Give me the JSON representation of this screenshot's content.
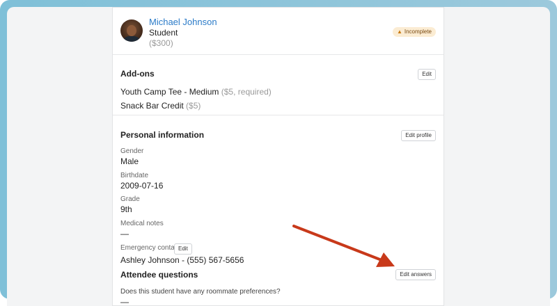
{
  "attendee": {
    "name": "Michael Johnson",
    "role": "Student",
    "price": "($300)",
    "status": "Incomplete"
  },
  "addons": {
    "title": "Add-ons",
    "edit_label": "Edit",
    "items": [
      {
        "label": "Youth Camp Tee - Medium",
        "detail": "($5, required)"
      },
      {
        "label": "Snack Bar Credit",
        "detail": "($5)"
      }
    ]
  },
  "personal": {
    "title": "Personal information",
    "edit_label": "Edit profile",
    "fields": [
      {
        "label": "Gender",
        "value": "Male"
      },
      {
        "label": "Birthdate",
        "value": "2009-07-16"
      },
      {
        "label": "Grade",
        "value": "9th"
      },
      {
        "label": "Medical notes",
        "value": "—"
      }
    ],
    "emergency": {
      "label": "Emergency contact",
      "edit_label": "Edit",
      "value": "Ashley Johnson - (555) 567-5656"
    }
  },
  "questions": {
    "title": "Attendee questions",
    "edit_label": "Edit answers",
    "items": [
      {
        "question": "Does this student have any roommate preferences?",
        "answer": "—"
      }
    ]
  },
  "colors": {
    "link": "#2b7bc8",
    "badge_bg": "#fbecd3",
    "annotation_arrow": "#c8391a"
  }
}
